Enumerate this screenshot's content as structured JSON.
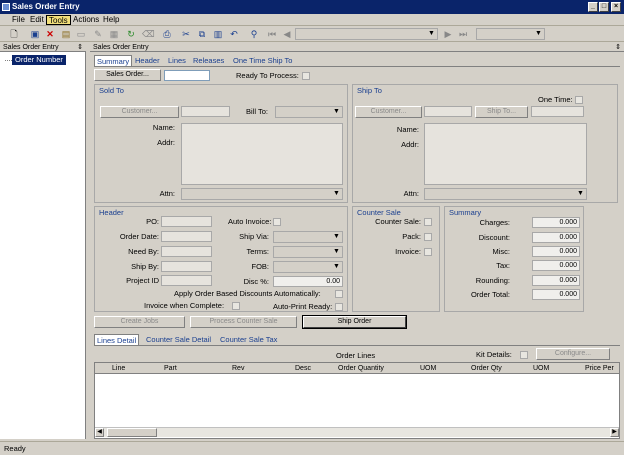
{
  "window": {
    "title": "Sales Order Entry",
    "minimize": "_",
    "maximize": "□",
    "close": "×"
  },
  "menu": [
    "File",
    "Edit",
    "Tools",
    "Actions",
    "Help"
  ],
  "left_panel": {
    "title": "Sales Order Entry",
    "pin": "⇕",
    "tree_item": "Order Number"
  },
  "main_panel": {
    "title": "Sales Order Entry",
    "pin": "⇕"
  },
  "tabs": [
    "Summary",
    "Header",
    "Lines",
    "Releases",
    "One Time Ship To"
  ],
  "top": {
    "sales_order_button": "Sales Order...",
    "sales_order_value": "",
    "ready_to_process_label": "Ready To Process:"
  },
  "sold_to": {
    "title": "Sold To",
    "customer_button": "Customer...",
    "bill_to_label": "Bill To:",
    "name_label": "Name:",
    "addr_label": "Addr:",
    "attn_label": "Attn:"
  },
  "ship_to": {
    "title": "Ship To",
    "one_time_label": "One Time:",
    "customer_button": "Customer...",
    "ship_to_button": "Ship To...",
    "name_label": "Name:",
    "addr_label": "Addr:",
    "attn_label": "Attn:"
  },
  "header": {
    "title": "Header",
    "po_label": "PO:",
    "auto_invoice_label": "Auto Invoice:",
    "order_date_label": "Order Date:",
    "ship_via_label": "Ship Via:",
    "need_by_label": "Need By:",
    "terms_label": "Terms:",
    "ship_by_label": "Ship By:",
    "fob_label": "FOB:",
    "project_id_label": "Project ID",
    "disc_label": "Disc %:",
    "disc_value": "0.00",
    "apply_discounts_label": "Apply Order Based Discounts Automatically:",
    "invoice_complete_label": "Invoice when Complete:",
    "auto_print_label": "Auto-Print Ready:"
  },
  "counter_sale": {
    "title": "Counter Sale",
    "counter_sale_label": "Counter Sale:",
    "pack_label": "Pack:",
    "invoice_label": "Invoice:"
  },
  "summary": {
    "title": "Summary",
    "rows": [
      {
        "label": "Charges:",
        "value": "0.000"
      },
      {
        "label": "Discount:",
        "value": "0.000"
      },
      {
        "label": "Misc:",
        "value": "0.000"
      },
      {
        "label": "Tax:",
        "value": "0.000"
      },
      {
        "label": "Rounding:",
        "value": "0.000"
      },
      {
        "label": "Order Total:",
        "value": "0.000"
      }
    ]
  },
  "actions": {
    "create_jobs": "Create Jobs",
    "process_counter_sale": "Process Counter Sale",
    "ship_order": "Ship Order"
  },
  "lower_tabs": [
    "Lines Detail",
    "Counter Sale Detail",
    "Counter Sale Tax"
  ],
  "lines": {
    "title": "Order Lines",
    "kit_details_label": "Kit Details:",
    "configure_button": "Configure...",
    "columns": [
      "Line",
      "Part",
      "Rev",
      "Desc",
      "Order Quantity",
      "UOM",
      "Order Qty",
      "UOM",
      "Price Per"
    ]
  },
  "status": "Ready"
}
